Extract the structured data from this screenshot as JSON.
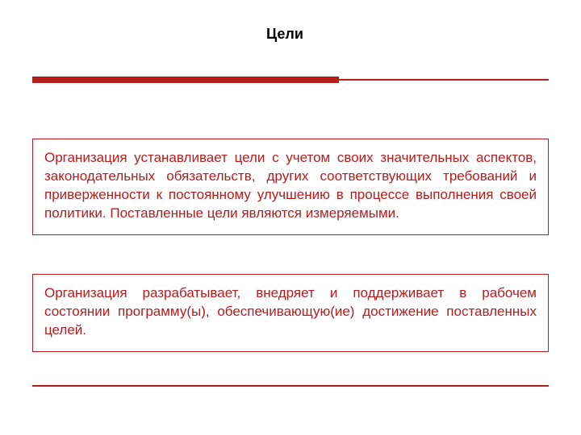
{
  "title": "Цели",
  "box1_text": "Организация устанавливает цели с учетом своих значительных аспектов, законодательных обязательств, других соответствующих требований и приверженности к постоянному улучшению в процессе выполнения своей политики. Поставленные цели являются измеряемыми.",
  "box2_text": "Организация разрабатывает, внедряет и поддерживает в рабочем состоянии программу(ы), обеспечивающую(ие) достижение поставленных целей.",
  "colors": {
    "accent": "#b51c1c"
  }
}
